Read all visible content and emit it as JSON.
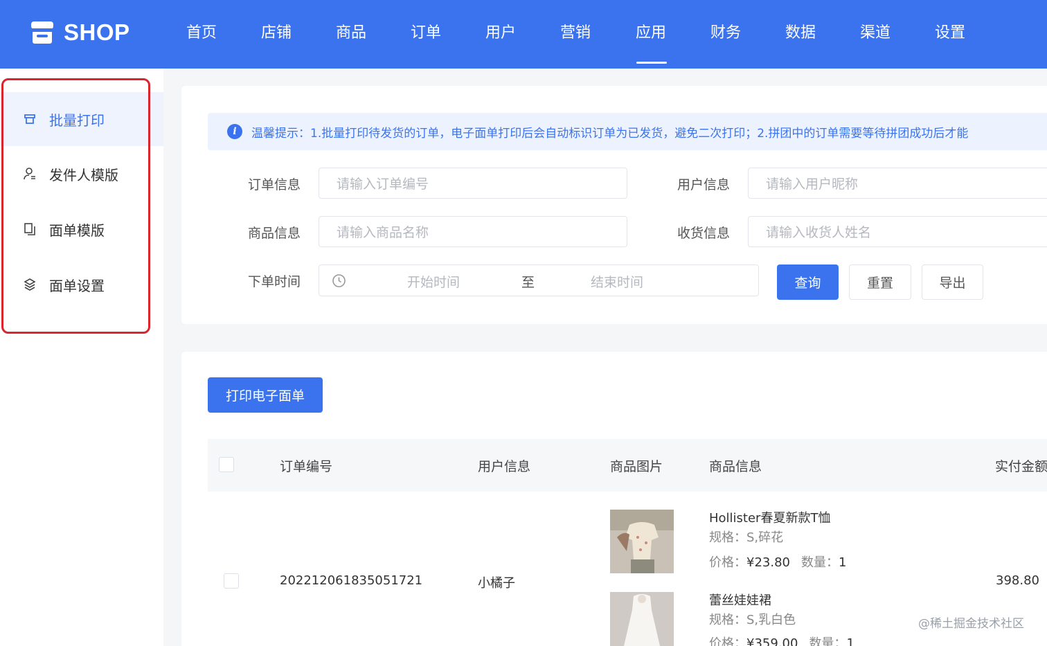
{
  "header": {
    "logo_text": "SHOP",
    "nav": [
      {
        "label": "首页"
      },
      {
        "label": "店铺"
      },
      {
        "label": "商品"
      },
      {
        "label": "订单"
      },
      {
        "label": "用户"
      },
      {
        "label": "营销"
      },
      {
        "label": "应用"
      },
      {
        "label": "财务"
      },
      {
        "label": "数据"
      },
      {
        "label": "渠道"
      },
      {
        "label": "设置"
      }
    ],
    "active_nav": "应用"
  },
  "sidebar": {
    "items": [
      {
        "label": "批量打印",
        "icon": "printer-icon",
        "active": true
      },
      {
        "label": "发件人模版",
        "icon": "user-icon",
        "active": false
      },
      {
        "label": "面单模版",
        "icon": "copy-icon",
        "active": false
      },
      {
        "label": "面单设置",
        "icon": "settings-icon",
        "active": false
      }
    ]
  },
  "notice": {
    "text": "温馨提示：1.批量打印待发货的订单，电子面单打印后会自动标识订单为已发货，避免二次打印；2.拼团中的订单需要等待拼团成功后才能"
  },
  "filters": {
    "order_label": "订单信息",
    "order_placeholder": "请输入订单编号",
    "user_label": "用户信息",
    "user_placeholder": "请输入用户昵称",
    "goods_label": "商品信息",
    "goods_placeholder": "请输入商品名称",
    "receiver_label": "收货信息",
    "receiver_placeholder": "请输入收货人姓名",
    "time_label": "下单时间",
    "start_placeholder": "开始时间",
    "separator": "至",
    "end_placeholder": "结束时间",
    "query_button": "查询",
    "reset_button": "重置",
    "export_button": "导出"
  },
  "table": {
    "print_button": "打印电子面单",
    "columns": [
      "订单编号",
      "用户信息",
      "商品图片",
      "商品信息",
      "实付金额"
    ],
    "rows": [
      {
        "order_no": "202212061835051721",
        "user": "小橘子",
        "paid": "398.80",
        "items": [
          {
            "name": "Hollister春夏新款T恤",
            "spec": "规格：S,碎花",
            "price_label": "价格：",
            "price": "¥23.80",
            "qty_label": "数量：",
            "qty": "1"
          },
          {
            "name": "蕾丝娃娃裙",
            "spec": "规格：S,乳白色",
            "price_label": "价格：",
            "price": "¥359.00",
            "qty_label": "数量：",
            "qty": "1"
          }
        ]
      }
    ]
  },
  "watermark": "@稀土掘金技术社区",
  "colors": {
    "primary": "#3b73ef",
    "highlight_border": "#d9252e",
    "notice_bg": "#edf3fe"
  }
}
